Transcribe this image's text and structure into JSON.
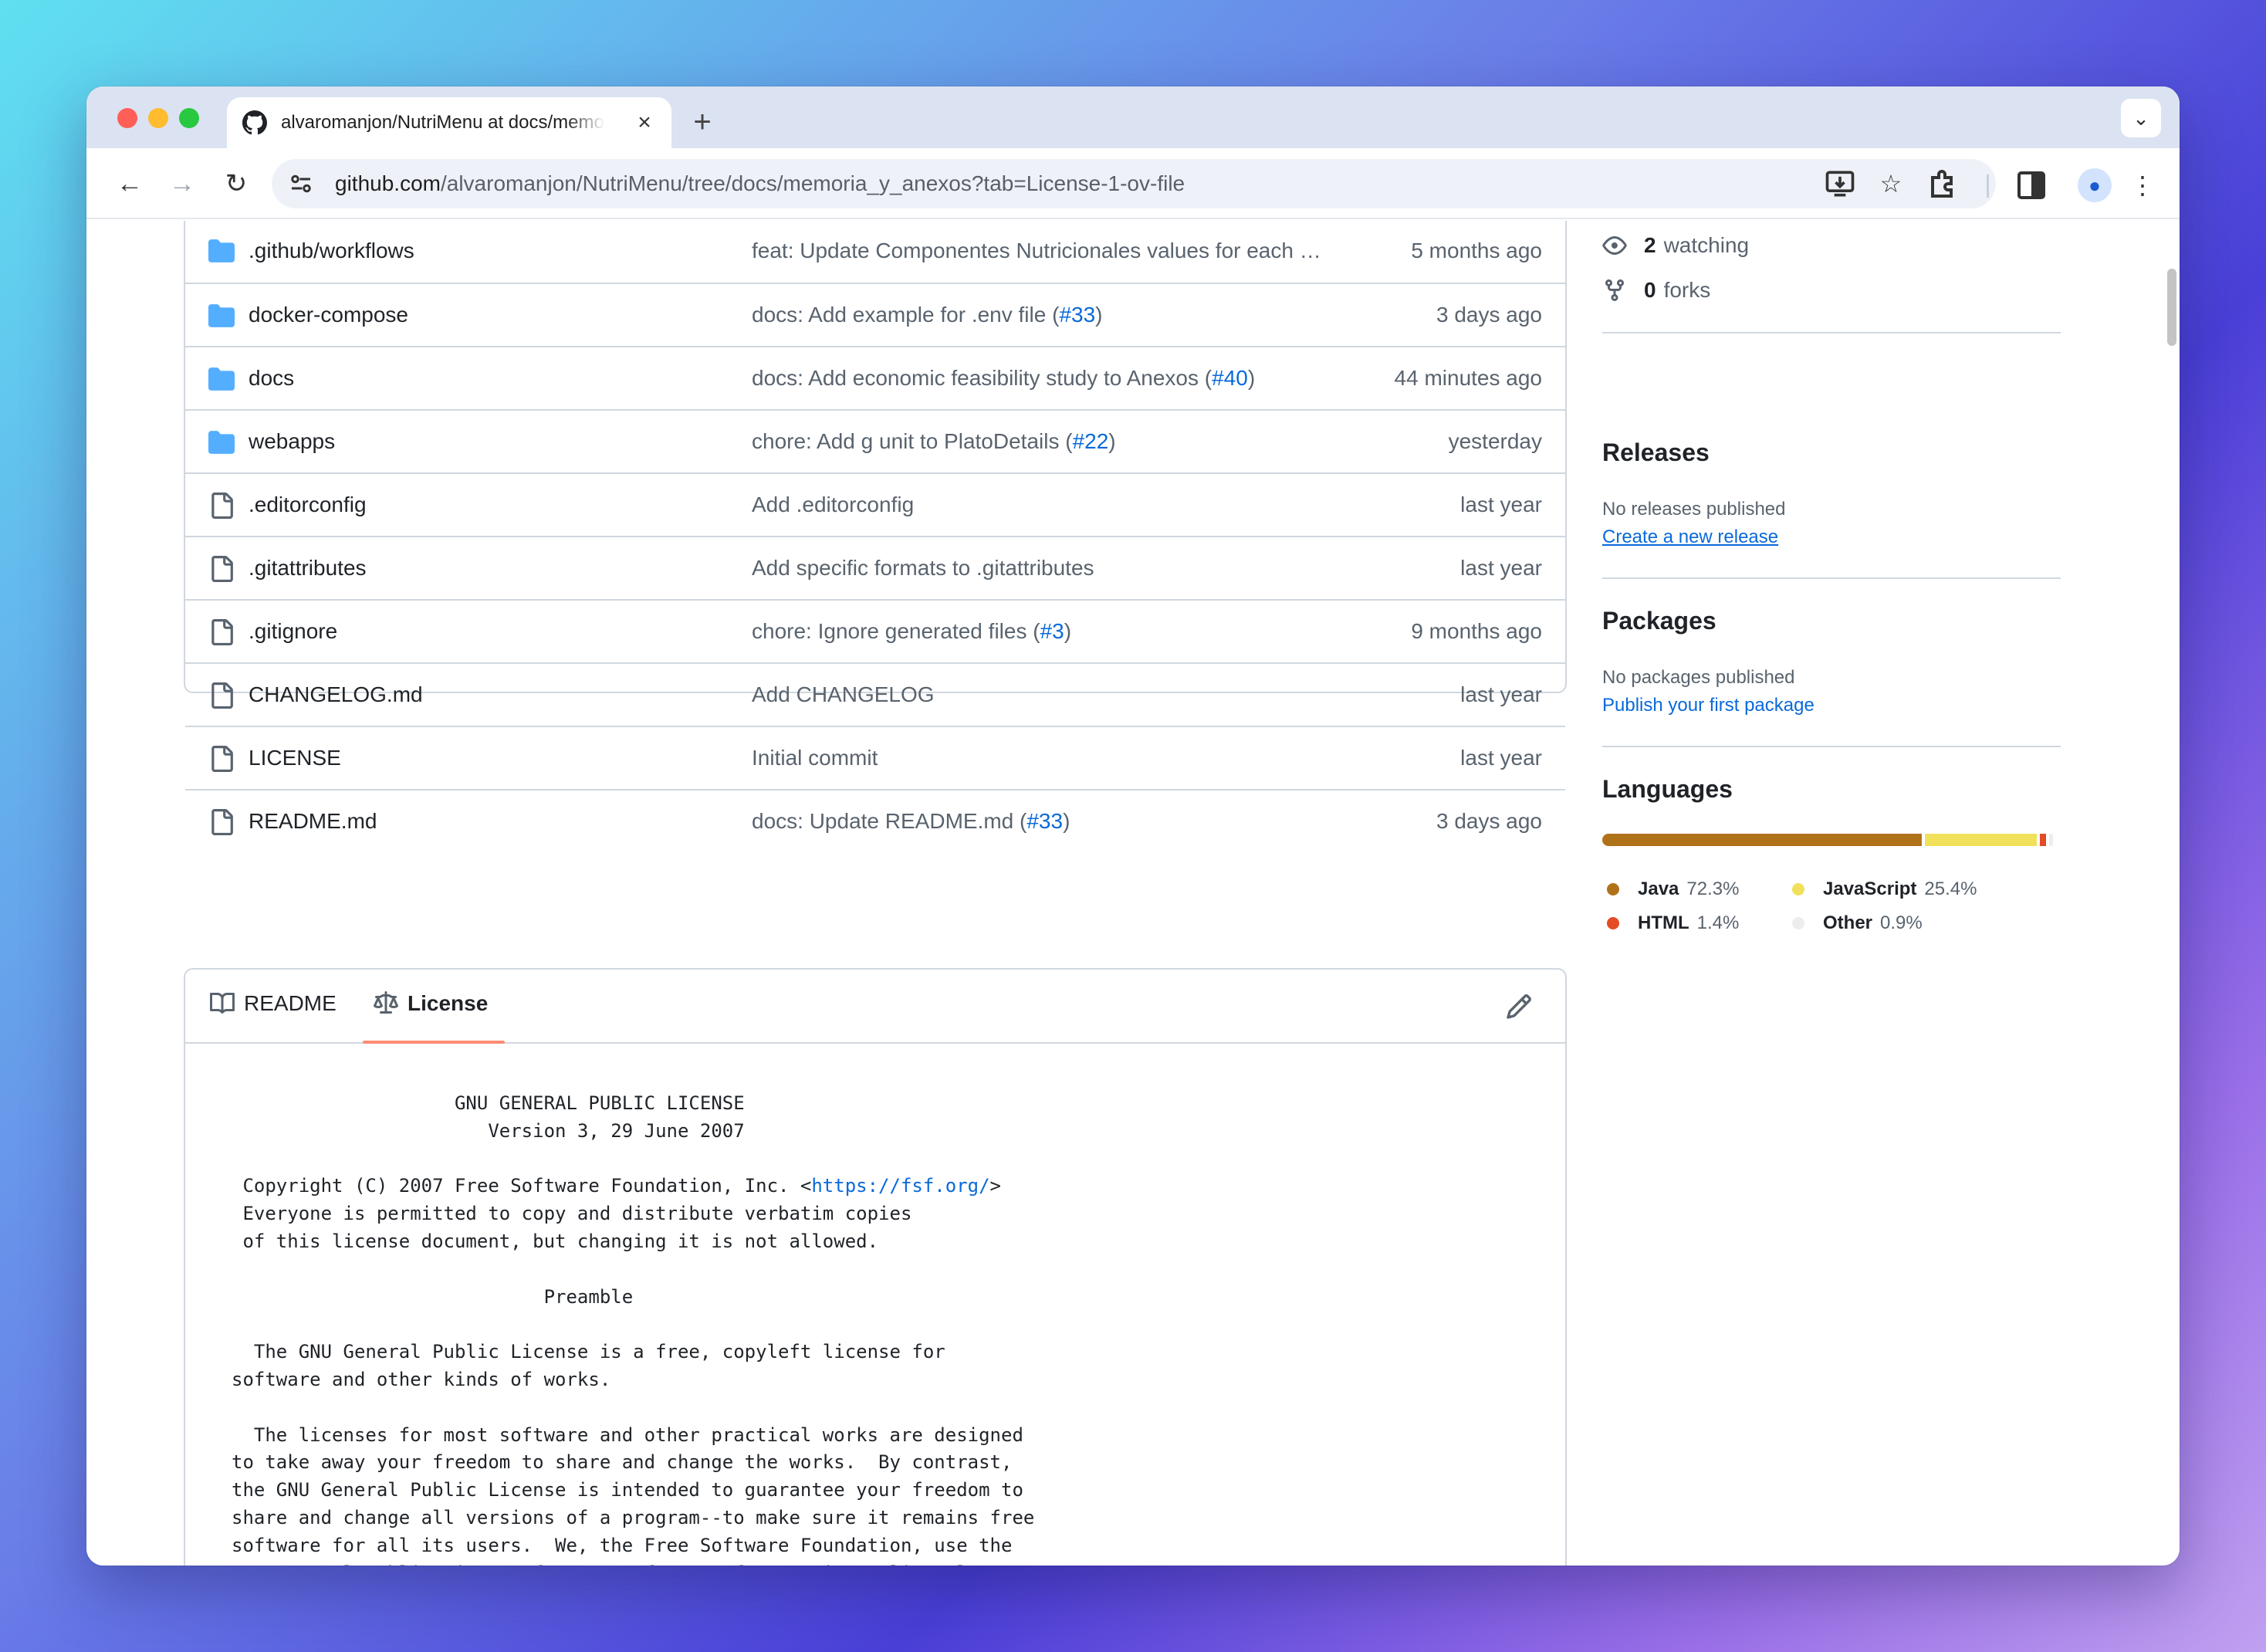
{
  "browser": {
    "tab_title": "alvaromanjon/NutriMenu at docs/memoria_y_anexos",
    "url_host": "github.com",
    "url_path": "/alvaromanjon/NutriMenu/tree/docs/memoria_y_anexos?tab=License-1-ov-file"
  },
  "files": [
    {
      "icon": "folder",
      "name": ".github/workflows",
      "message": "feat: Update Componentes Nutricionales values for each …",
      "pr": "",
      "time": "5 months ago"
    },
    {
      "icon": "folder",
      "name": "docker-compose",
      "message": "docs: Add example for .env file (",
      "pr": "#33",
      "time": "3 days ago"
    },
    {
      "icon": "folder",
      "name": "docs",
      "message": "docs: Add economic feasibility study to Anexos (",
      "pr": "#40",
      "time": "44 minutes ago"
    },
    {
      "icon": "folder",
      "name": "webapps",
      "message": "chore: Add g unit to PlatoDetails (",
      "pr": "#22",
      "time": "yesterday"
    },
    {
      "icon": "file",
      "name": ".editorconfig",
      "message": "Add .editorconfig",
      "pr": "",
      "time": "last year"
    },
    {
      "icon": "file",
      "name": ".gitattributes",
      "message": "Add specific formats to .gitattributes",
      "pr": "",
      "time": "last year"
    },
    {
      "icon": "file",
      "name": ".gitignore",
      "message": "chore: Ignore generated files (",
      "pr": "#3",
      "time": "9 months ago"
    },
    {
      "icon": "file",
      "name": "CHANGELOG.md",
      "message": "Add CHANGELOG",
      "pr": "",
      "time": "last year"
    },
    {
      "icon": "file",
      "name": "LICENSE",
      "message": "Initial commit",
      "pr": "",
      "time": "last year"
    },
    {
      "icon": "file",
      "name": "README.md",
      "message": "docs: Update README.md (",
      "pr": "#33",
      "time": "3 days ago"
    }
  ],
  "readme_tabs": {
    "readme": "README",
    "license": "License"
  },
  "license": {
    "line1": "                    GNU GENERAL PUBLIC LICENSE",
    "line2": "                       Version 3, 29 June 2007",
    "copyright_pre": " Copyright (C) 2007 Free Software Foundation, Inc. <",
    "copyright_link": "https://fsf.org/",
    "copyright_post": ">",
    "line4": " Everyone is permitted to copy and distribute verbatim copies",
    "line5": " of this license document, but changing it is not allowed.",
    "preamble": "                            Preamble",
    "para1": "  The GNU General Public License is a free, copyleft license for\nsoftware and other kinds of works.",
    "para2": "  The licenses for most software and other practical works are designed\nto take away your freedom to share and change the works.  By contrast,\nthe GNU General Public License is intended to guarantee your freedom to\nshare and change all versions of a program--to make sure it remains free\nsoftware for all its users.  We, the Free Software Foundation, use the\nGNU General Public License for most of our software; it applies also to\nany other work released this way by its authors.  You can apply it to\nyour programs, too."
  },
  "sidebar": {
    "watching_count": "2",
    "watching_label": "watching",
    "forks_count": "0",
    "forks_label": "forks",
    "releases_title": "Releases",
    "releases_empty": "No releases published",
    "releases_link": "Create a new release",
    "packages_title": "Packages",
    "packages_empty": "No packages published",
    "packages_link": "Publish your first package",
    "languages_title": "Languages",
    "languages": [
      {
        "name": "Java",
        "percent": "72.3%",
        "value": 72.3,
        "color": "#b07219"
      },
      {
        "name": "JavaScript",
        "percent": "25.4%",
        "value": 25.4,
        "color": "#f1e05a"
      },
      {
        "name": "HTML",
        "percent": "1.4%",
        "value": 1.4,
        "color": "#e34c26"
      },
      {
        "name": "Other",
        "percent": "0.9%",
        "value": 0.9,
        "color": "#ededed"
      }
    ]
  }
}
